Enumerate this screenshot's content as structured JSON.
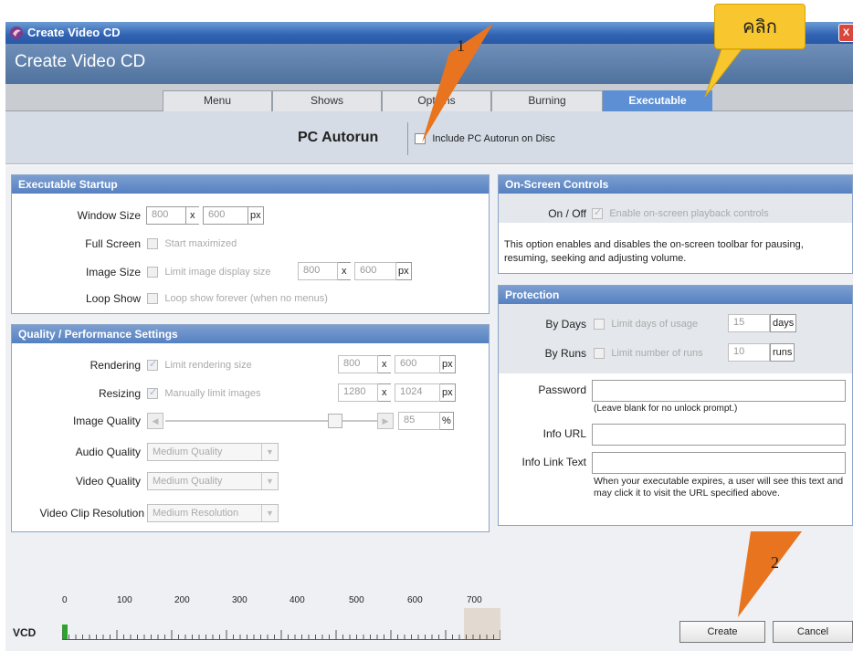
{
  "window": {
    "title": "Create Video CD",
    "header": "Create Video CD",
    "close_glyph": "X"
  },
  "tabs": [
    {
      "label": "Menu",
      "active": false
    },
    {
      "label": "Shows",
      "active": false
    },
    {
      "label": "Options",
      "active": false
    },
    {
      "label": "Burning",
      "active": false
    },
    {
      "label": "Executable",
      "active": true
    }
  ],
  "autorun": {
    "title": "PC Autorun",
    "checkbox_label": "Include PC Autorun on Disc"
  },
  "executable_startup": {
    "heading": "Executable Startup",
    "window_size": {
      "label": "Window Size",
      "width": "800",
      "height": "600",
      "unit": "px"
    },
    "full_screen": {
      "label": "Full Screen",
      "checkbox_label": "Start maximized"
    },
    "image_size": {
      "label": "Image Size",
      "checkbox_label": "Limit image display size",
      "width": "800",
      "height": "600",
      "unit": "px"
    },
    "loop_show": {
      "label": "Loop Show",
      "checkbox_label": "Loop show forever (when no menus)"
    }
  },
  "quality": {
    "heading": "Quality / Performance Settings",
    "rendering": {
      "label": "Rendering",
      "checkbox_label": "Limit rendering size",
      "width": "800",
      "height": "600",
      "unit": "px"
    },
    "resizing": {
      "label": "Resizing",
      "checkbox_label": "Manually limit images",
      "width": "1280",
      "height": "1024",
      "unit": "px"
    },
    "image_quality": {
      "label": "Image Quality",
      "value": "85",
      "unit": "%"
    },
    "audio_quality": {
      "label": "Audio Quality",
      "value": "Medium Quality"
    },
    "video_quality": {
      "label": "Video Quality",
      "value": "Medium Quality"
    },
    "video_clip_resolution": {
      "label": "Video Clip Resolution",
      "value": "Medium Resolution"
    }
  },
  "onscreen": {
    "heading": "On-Screen Controls",
    "label": "On / Off",
    "checkbox_label": "Enable on-screen playback controls",
    "description": "This option enables and disables the on-screen toolbar for pausing, resuming, seeking and adjusting volume."
  },
  "protection": {
    "heading": "Protection",
    "by_days": {
      "label": "By Days",
      "checkbox_label": "Limit days of usage",
      "value": "15",
      "unit": "days"
    },
    "by_runs": {
      "label": "By Runs",
      "checkbox_label": "Limit number of runs",
      "value": "10",
      "unit": "runs"
    },
    "password": {
      "label": "Password",
      "value": "",
      "hint": "(Leave blank for no unlock prompt.)"
    },
    "info_url": {
      "label": "Info URL",
      "value": ""
    },
    "info_link_text": {
      "label": "Info Link Text",
      "value": "",
      "hint": "When your executable expires, a user will see this text and may click it to visit the URL specified above."
    }
  },
  "footer": {
    "disc_type": "VCD",
    "ruler_ticks": [
      "0",
      "100",
      "200",
      "300",
      "400",
      "500",
      "600",
      "700"
    ],
    "create_label": "Create",
    "cancel_label": "Cancel"
  },
  "annotations": {
    "callout_text": "คลิก",
    "step1": "1",
    "step2": "2"
  },
  "colors": {
    "accent": "#5d8fd4",
    "titlebar": "#2f63b3",
    "callout": "#f8c62e",
    "arrow": "#e8741f"
  }
}
